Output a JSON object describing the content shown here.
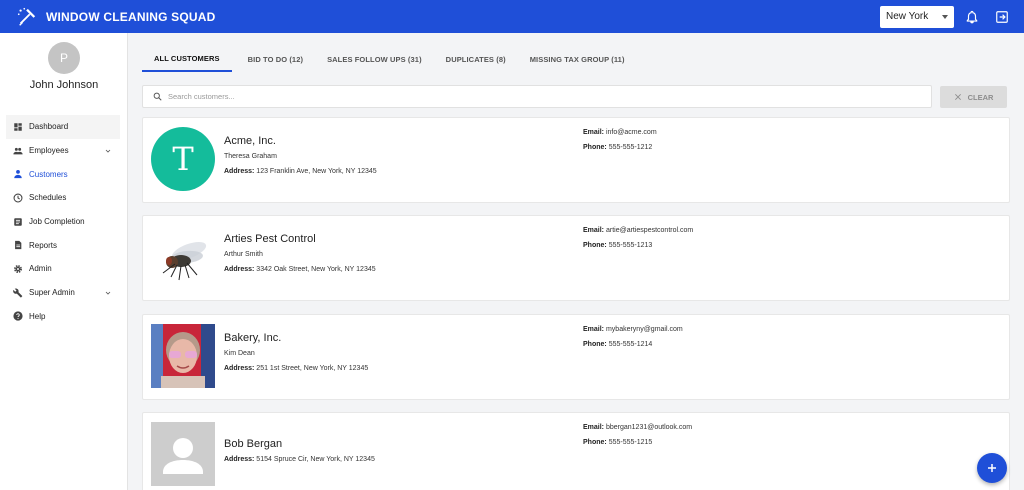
{
  "app": {
    "title": "WINDOW CLEANING SQUAD",
    "brand_color": "#1f4fd8"
  },
  "header": {
    "location": "New York"
  },
  "user": {
    "initial": "P",
    "name": "John Johnson"
  },
  "sidebar": {
    "items": [
      {
        "label": "Dashboard",
        "icon": "dashboard-icon"
      },
      {
        "label": "Employees",
        "icon": "people-icon",
        "expandable": true
      },
      {
        "label": "Customers",
        "icon": "person-icon",
        "active": true
      },
      {
        "label": "Schedules",
        "icon": "clock-icon"
      },
      {
        "label": "Job Completion",
        "icon": "list-icon"
      },
      {
        "label": "Reports",
        "icon": "document-icon"
      },
      {
        "label": "Admin",
        "icon": "gear-icon"
      },
      {
        "label": "Super Admin",
        "icon": "wrench-icon",
        "expandable": true
      },
      {
        "label": "Help",
        "icon": "help-icon"
      }
    ]
  },
  "tabs": [
    {
      "label": "ALL CUSTOMERS",
      "active": true
    },
    {
      "label": "BID TO DO (12)"
    },
    {
      "label": "SALES FOLLOW UPS (31)"
    },
    {
      "label": "DUPLICATES (8)"
    },
    {
      "label": "MISSING TAX GROUP (11)"
    }
  ],
  "search": {
    "placeholder": "Search customers..."
  },
  "clear": {
    "label": "CLEAR"
  },
  "labels": {
    "email": "Email:",
    "phone": "Phone:",
    "address": "Address:"
  },
  "customers": [
    {
      "name": "Acme, Inc.",
      "contact": "Theresa Graham",
      "address": "123 Franklin Ave, New York, NY 12345",
      "email": "info@acme.com",
      "phone": "555-555-1212",
      "avatar_letter": "T",
      "avatar_type": "letter"
    },
    {
      "name": "Arties Pest Control",
      "contact": "Arthur Smith",
      "address": "3342 Oak Street, New York, NY 12345",
      "email": "artie@artiespestcontrol.com",
      "phone": "555-555-1213",
      "avatar_type": "fly-photo"
    },
    {
      "name": "Bakery, Inc.",
      "contact": "Kim Dean",
      "address": "251 1st Street, New York, NY 12345",
      "email": "mybakeryny@gmail.com",
      "phone": "555-555-1214",
      "avatar_type": "person-photo"
    },
    {
      "name": "Bob Bergan",
      "contact": "",
      "address": "5154 Spruce Cir, New York, NY 12345",
      "email": "bbergan1231@outlook.com",
      "phone": "555-555-1215",
      "avatar_type": "placeholder"
    }
  ]
}
